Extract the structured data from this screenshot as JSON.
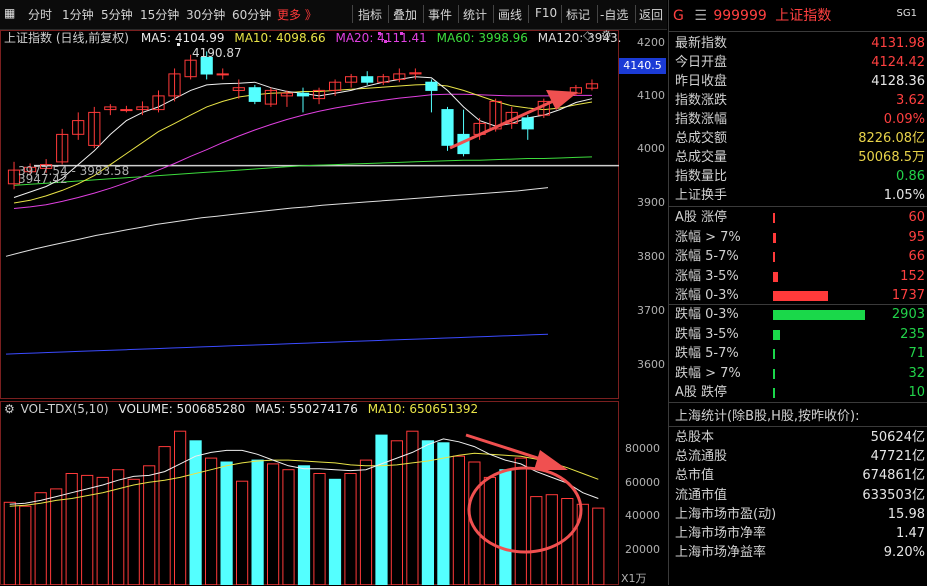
{
  "toolbar": {
    "left_items": [
      "分时",
      "1分钟",
      "5分钟",
      "15分钟",
      "30分钟",
      "60分钟",
      "更多 》"
    ],
    "right_items": [
      "指标",
      "叠加",
      "事件",
      "统计",
      "画线",
      "F10",
      "标记",
      "-自选",
      "返回"
    ]
  },
  "main_chart": {
    "title": "上证指数 (日线,前复权)",
    "ma5_label": "MA5: 4104.99",
    "ma10_label": "MA10: 4098.66",
    "ma20_label": "MA20: 4111.41",
    "ma60_label": "MA60: 3998.96",
    "ma120_label": "MA120: 3943.",
    "high_label": "4190.87",
    "range_label": "3977.54 - 3983.58",
    "low_label": "3947.42",
    "price_tag": "4140.5",
    "y_ticks": [
      "4200",
      "4100",
      "4000",
      "3900",
      "3800",
      "3700",
      "3600"
    ]
  },
  "volume_chart": {
    "title": "VOL-TDX(5,10)",
    "volume_label": "VOLUME: 500685280",
    "ma5_label": "MA5: 550274176",
    "ma10_label": "MA10: 650651392",
    "y_ticks": [
      "80000",
      "60000",
      "40000",
      "20000"
    ],
    "unit_label": "X1万"
  },
  "chart_data": {
    "type": "candlestick",
    "y_range": [
      3560,
      4230
    ],
    "candles": [
      {
        "o": 3950,
        "c": 3975,
        "h": 3990,
        "l": 3940
      },
      {
        "o": 3972,
        "c": 3980,
        "h": 3987,
        "l": 3965
      },
      {
        "o": 3978,
        "c": 3985,
        "h": 3995,
        "l": 3970
      },
      {
        "o": 3990,
        "c": 4040,
        "h": 4050,
        "l": 3985
      },
      {
        "o": 4040,
        "c": 4065,
        "h": 4080,
        "l": 4030
      },
      {
        "o": 4020,
        "c": 4080,
        "h": 4090,
        "l": 4015
      },
      {
        "o": 4085,
        "c": 4090,
        "h": 4095,
        "l": 4075
      },
      {
        "o": 4085,
        "c": 4085,
        "h": 4092,
        "l": 4080
      },
      {
        "o": 4085,
        "c": 4090,
        "h": 4100,
        "l": 4075
      },
      {
        "o": 4085,
        "c": 4110,
        "h": 4120,
        "l": 4080
      },
      {
        "o": 4110,
        "c": 4150,
        "h": 4160,
        "l": 4100
      },
      {
        "o": 4145,
        "c": 4175,
        "h": 4185,
        "l": 4140
      },
      {
        "o": 4180,
        "c": 4150,
        "h": 4191,
        "l": 4140
      },
      {
        "o": 4150,
        "c": 4150,
        "h": 4160,
        "l": 4140
      },
      {
        "o": 4120,
        "c": 4125,
        "h": 4140,
        "l": 4105
      },
      {
        "o": 4125,
        "c": 4100,
        "h": 4130,
        "l": 4095
      },
      {
        "o": 4095,
        "c": 4120,
        "h": 4125,
        "l": 4090
      },
      {
        "o": 4110,
        "c": 4115,
        "h": 4120,
        "l": 4090
      },
      {
        "o": 4115,
        "c": 4110,
        "h": 4125,
        "l": 4080
      },
      {
        "o": 4105,
        "c": 4120,
        "h": 4125,
        "l": 4095
      },
      {
        "o": 4120,
        "c": 4135,
        "h": 4140,
        "l": 4110
      },
      {
        "o": 4135,
        "c": 4145,
        "h": 4150,
        "l": 4125
      },
      {
        "o": 4145,
        "c": 4135,
        "h": 4155,
        "l": 4130
      },
      {
        "o": 4135,
        "c": 4145,
        "h": 4150,
        "l": 4130
      },
      {
        "o": 4140,
        "c": 4150,
        "h": 4160,
        "l": 4135
      },
      {
        "o": 4150,
        "c": 4152,
        "h": 4160,
        "l": 4140
      },
      {
        "o": 4135,
        "c": 4120,
        "h": 4140,
        "l": 4080
      },
      {
        "o": 4085,
        "c": 4020,
        "h": 4090,
        "l": 4010
      },
      {
        "o": 4040,
        "c": 4005,
        "h": 4085,
        "l": 4000
      },
      {
        "o": 4040,
        "c": 4060,
        "h": 4070,
        "l": 4030
      },
      {
        "o": 4050,
        "c": 4100,
        "h": 4105,
        "l": 4045
      },
      {
        "o": 4060,
        "c": 4080,
        "h": 4090,
        "l": 4050
      },
      {
        "o": 4070,
        "c": 4050,
        "h": 4075,
        "l": 4030
      },
      {
        "o": 4075,
        "c": 4100,
        "h": 4105,
        "l": 4070
      },
      {
        "o": 4100,
        "c": 4110,
        "h": 4115,
        "l": 4095
      },
      {
        "o": 4115,
        "c": 4125,
        "h": 4130,
        "l": 4110
      },
      {
        "o": 4124,
        "c": 4132,
        "h": 4140,
        "l": 4120
      }
    ],
    "ma5": [
      3925,
      3935,
      3945,
      3960,
      3985,
      4010,
      4040,
      4065,
      4080,
      4090,
      4105,
      4120,
      4130,
      4132,
      4133,
      4135,
      4125,
      4118,
      4115,
      4110,
      4115,
      4120,
      4128,
      4135,
      4140,
      4145,
      4143,
      4120,
      4090,
      4065,
      4055,
      4060,
      4070,
      4075,
      4085,
      4098,
      4105
    ],
    "ma10": [
      3915,
      3920,
      3928,
      3938,
      3950,
      3965,
      3985,
      4005,
      4025,
      4045,
      4060,
      4075,
      4090,
      4100,
      4108,
      4112,
      4115,
      4116,
      4118,
      4118,
      4120,
      4122,
      4124,
      4126,
      4128,
      4130,
      4131,
      4128,
      4120,
      4110,
      4100,
      4092,
      4088,
      4085,
      4088,
      4094,
      4099
    ],
    "ma20": [
      3905,
      3908,
      3912,
      3918,
      3925,
      3933,
      3942,
      3952,
      3963,
      3975,
      3987,
      4000,
      4012,
      4025,
      4037,
      4048,
      4058,
      4067,
      4075,
      4082,
      4088,
      4093,
      4098,
      4102,
      4106,
      4109,
      4112,
      4113,
      4113,
      4112,
      4111,
      4110,
      4110,
      4110,
      4110,
      4111,
      4111
    ],
    "ma60": [
      3947,
      3949,
      3951,
      3953,
      3955,
      3957,
      3959,
      3961,
      3963,
      3965,
      3967,
      3969,
      3971,
      3973,
      3975,
      3977,
      3979,
      3981,
      3983,
      3984,
      3985,
      3986,
      3987,
      3988,
      3989,
      3990,
      3991,
      3992,
      3993,
      3993,
      3994,
      3995,
      3996,
      3996,
      3997,
      3998,
      3999
    ],
    "ma120": [
      3818,
      3825,
      3832,
      3838,
      3844,
      3850,
      3856,
      3861,
      3866,
      3871,
      3876,
      3880,
      3884,
      3888,
      3891,
      3894,
      3897,
      3900,
      3903,
      3906,
      3908,
      3911,
      3913,
      3915,
      3917,
      3919,
      3921,
      3923,
      3925,
      3927,
      3929,
      3931,
      3933,
      3935,
      3937,
      3940,
      3943
    ],
    "ma250": [
      3640,
      3641,
      3642,
      3643,
      3644,
      3645,
      3646,
      3647,
      3648,
      3649,
      3650,
      3651,
      3652,
      3653,
      3654,
      3655,
      3656,
      3657,
      3658,
      3659,
      3660,
      3661,
      3662,
      3663,
      3664,
      3665,
      3666,
      3667,
      3668,
      3669,
      3670,
      3671,
      3672,
      3673,
      3674,
      3675,
      3676
    ],
    "support_level": 3983,
    "volume": {
      "y_range": [
        10000,
        100000
      ],
      "values": [
        53000,
        51000,
        58000,
        60000,
        68000,
        67000,
        66000,
        70000,
        65000,
        72000,
        82000,
        90000,
        85000,
        76000,
        74000,
        64000,
        75000,
        73000,
        70000,
        72000,
        68000,
        65000,
        68000,
        75000,
        88000,
        85000,
        90000,
        85000,
        84000,
        77000,
        74000,
        66000,
        70000,
        76000,
        56000,
        57000,
        55000,
        52000,
        50000
      ],
      "up": [
        true,
        true,
        true,
        true,
        true,
        true,
        true,
        true,
        true,
        true,
        true,
        true,
        false,
        true,
        false,
        true,
        false,
        true,
        true,
        false,
        true,
        false,
        true,
        true,
        false,
        true,
        true,
        false,
        false,
        true,
        true,
        true,
        false,
        true,
        true,
        true,
        true,
        true,
        true
      ],
      "ma5": [
        52000,
        52500,
        54000,
        56000,
        58000,
        60000,
        62000,
        64500,
        66500,
        67000,
        69000,
        73000,
        77000,
        79000,
        80000,
        80000,
        78000,
        75000,
        72000,
        70500,
        70500,
        70000,
        69500,
        70000,
        73000,
        76000,
        79000,
        83000,
        86000,
        84500,
        82000,
        78000,
        75000,
        73000,
        69000,
        66000,
        63000,
        58000,
        55000
      ],
      "ma10": [
        51000,
        51500,
        52500,
        54000,
        55000,
        56500,
        58000,
        60000,
        62000,
        63500,
        64500,
        66000,
        68000,
        70000,
        72000,
        73500,
        74500,
        75000,
        75000,
        74500,
        74000,
        73500,
        72500,
        72000,
        72000,
        72500,
        73500,
        74500,
        76000,
        77500,
        78500,
        78000,
        77500,
        77000,
        75500,
        73500,
        71000,
        68000,
        65000
      ]
    }
  },
  "quote": {
    "symbol_prefix": "G",
    "menu_icon": "☰",
    "code": "999999",
    "name": "上证指数",
    "badge": "SG1",
    "rows": [
      {
        "label": "最新指数",
        "value": "4131.98",
        "color": "red"
      },
      {
        "label": "今日开盘",
        "value": "4124.42",
        "color": "red"
      },
      {
        "label": "昨日收盘",
        "value": "4128.36",
        "color": "white"
      },
      {
        "label": "指数涨跌",
        "value": "3.62",
        "color": "red"
      },
      {
        "label": "指数涨幅",
        "value": "0.09%",
        "color": "red"
      },
      {
        "label": "总成交额",
        "value": "8226.08亿",
        "color": "yellow"
      },
      {
        "label": "总成交量",
        "value": "50068.5万",
        "color": "yellow"
      },
      {
        "label": "指数量比",
        "value": "0.86",
        "color": "green"
      },
      {
        "label": "上证换手",
        "value": "1.05%",
        "color": "white"
      }
    ]
  },
  "breadth": {
    "up": [
      {
        "label": "A股 涨停",
        "value": "60",
        "count": 60
      },
      {
        "label": "涨幅 > 7%",
        "value": "95",
        "count": 95
      },
      {
        "label": "涨幅 5-7%",
        "value": "66",
        "count": 66
      },
      {
        "label": "涨幅 3-5%",
        "value": "152",
        "count": 152
      },
      {
        "label": "涨幅 0-3%",
        "value": "1737",
        "count": 1737
      }
    ],
    "down": [
      {
        "label": "跌幅 0-3%",
        "value": "2903",
        "count": 2903
      },
      {
        "label": "跌幅 3-5%",
        "value": "235",
        "count": 235
      },
      {
        "label": "跌幅 5-7%",
        "value": "71",
        "count": 71
      },
      {
        "label": "跌幅 > 7%",
        "value": "32",
        "count": 32
      },
      {
        "label": "A股 跌停",
        "value": "10",
        "count": 10
      }
    ]
  },
  "market_stats": {
    "title": "上海统计(除B股,H股,按昨收价):",
    "rows": [
      {
        "label": "总股本",
        "value": "50624亿"
      },
      {
        "label": "总流通股",
        "value": "47721亿"
      },
      {
        "label": "总市值",
        "value": "674861亿"
      },
      {
        "label": "流通市值",
        "value": "633503亿"
      },
      {
        "label": "上海市场市盈(动)",
        "value": "15.98"
      },
      {
        "label": "上海市场市净率",
        "value": "1.47"
      },
      {
        "label": "上海市场净益率",
        "value": "9.20%"
      }
    ]
  }
}
